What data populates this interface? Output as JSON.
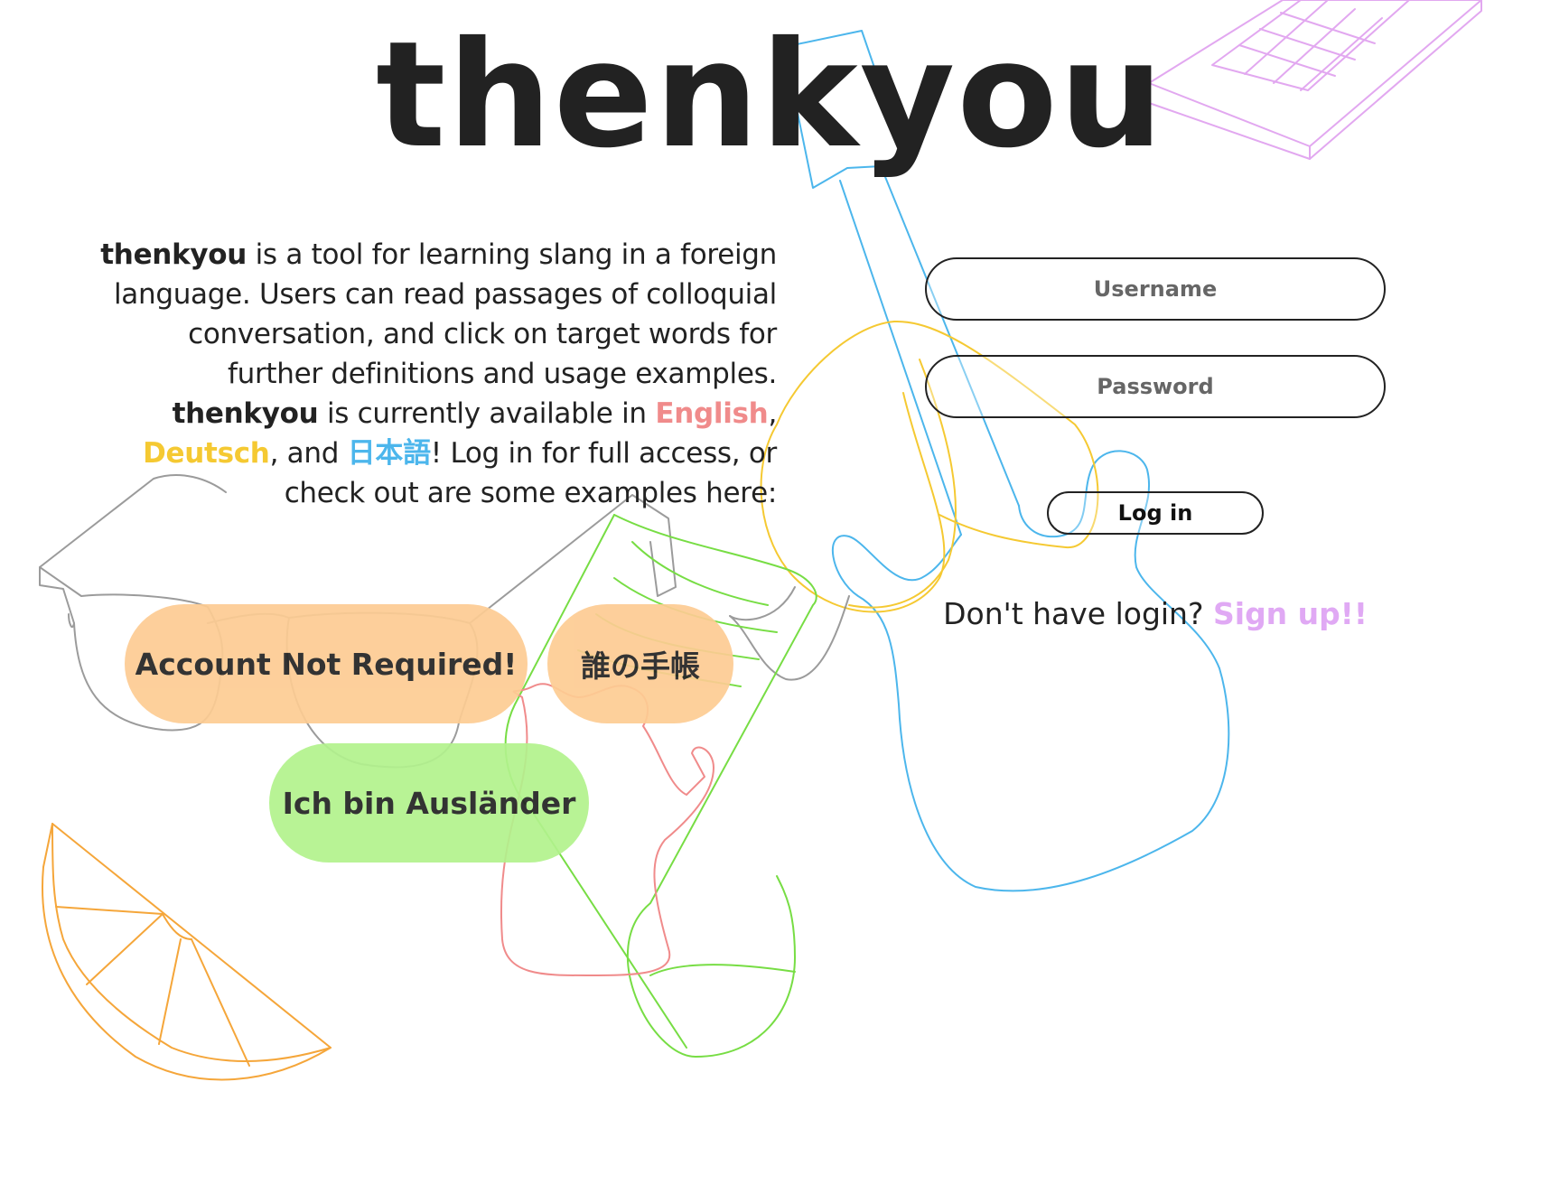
{
  "brand": {
    "logo": "thenkyou"
  },
  "intro": {
    "brand_1": "thenkyou",
    "text_1": " is a tool for learning slang in a foreign language. Users can read passages of colloquial conversation, and click on target words for further definitions and usage examples. ",
    "brand_2": "thenkyou",
    "text_2": " is currently available in ",
    "languages": [
      {
        "label": "English",
        "color": "#f08b8b"
      },
      {
        "label": "Deutsch",
        "color": "#f5c932"
      },
      {
        "label": "日本語",
        "color": "#4cb6ec"
      }
    ],
    "sep_1": ", ",
    "sep_2": ", and ",
    "text_3": "! Log in for full access, or check out are some examples here:"
  },
  "examples": [
    {
      "label": "Account Not Required!",
      "color": "#fdcc93"
    },
    {
      "label": "誰の手帳",
      "color": "#fdcc93"
    },
    {
      "label": "Ich bin Ausländer",
      "color": "#b2f28d"
    }
  ],
  "login": {
    "username_placeholder": "Username",
    "password_placeholder": "Password",
    "button_label": "Log in",
    "signup_prompt": "Don't have login? ",
    "signup_link": "Sign up!!"
  },
  "doodles": {
    "icons": [
      "keyboard-icon",
      "guitar-icon",
      "banana-icon",
      "glasses-icon",
      "wine-glass-icon",
      "squirrel-icon",
      "orange-slice-icon"
    ],
    "colors": {
      "keyboard": "#e2a8f0",
      "guitar": "#4cb6ec",
      "banana": "#f5c932",
      "glasses": "#8a8a8a",
      "wine_glass": "#77dd44",
      "squirrel": "#f08b8b",
      "orange": "#f5a63a"
    }
  }
}
